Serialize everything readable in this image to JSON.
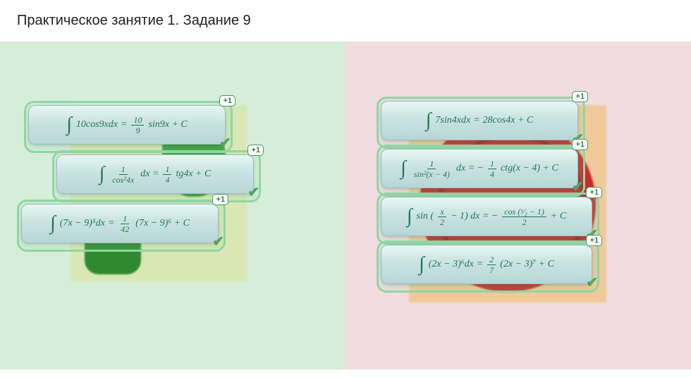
{
  "title": "Практическое занятие 1. Задание 9",
  "badge": "+1",
  "left": {
    "cards": [
      {
        "lhsA": "10cos9xdx",
        "eq": "=",
        "fracN": "10",
        "fracD": "9",
        "rhsB": "sin9x + C"
      },
      {
        "fracN": "1",
        "fracD": "cos²4x",
        "mid": "dx =",
        "frac2N": "1",
        "frac2D": "4",
        "rhsB": "tg4x + C"
      },
      {
        "lhsA": "(7x − 9)⁵dx",
        "eq": "=",
        "fracN": "1",
        "fracD": "42",
        "rhsB": "(7x − 9)⁶ + C"
      }
    ]
  },
  "right": {
    "cards": [
      {
        "lhsA": "7sin4xdx",
        "eq": "=",
        "rhsFull": "28cos4x + C"
      },
      {
        "fracN": "1",
        "fracD": "sin²(x − 4)",
        "mid": "dx = −",
        "frac2N": "1",
        "frac2D": "4",
        "rhsB": "ctg(x − 4) + C"
      },
      {
        "lhsInner": "sin (",
        "fracN": "x",
        "fracD": "2",
        "lhsTail": "− 1) dx = −",
        "frac2N": "cos (ˣ⁄₂ − 1)",
        "frac2D": "2",
        "rhsB": "+ C"
      },
      {
        "lhsA": "(2x − 3)⁶dx",
        "eq": "=",
        "fracN": "2",
        "fracD": "7",
        "rhsB": "(2x − 3)⁷ + C"
      }
    ]
  }
}
